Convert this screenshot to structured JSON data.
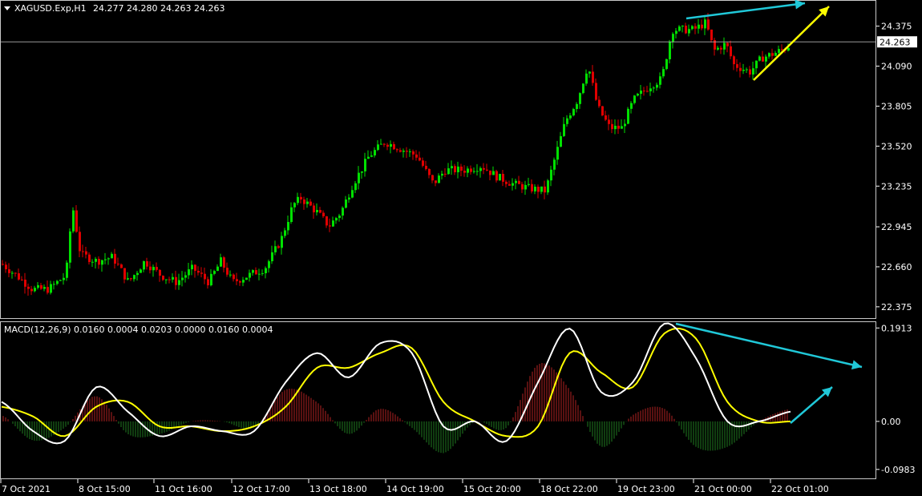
{
  "symbol_header": {
    "symbol": "XAGUSD.Exp,H1",
    "ohlc": "24.277 24.280 24.263 24.263"
  },
  "macd_header": {
    "label": "MACD(12,26,9) 0.0160 0.0004 0.0203 0.0000 0.0160 0.0004"
  },
  "colors": {
    "background": "#000000",
    "bull": "#00e000",
    "bear": "#e00000",
    "hist_up": "#b22222",
    "hist_down": "#1f7a1f",
    "macd_line": "#ffffff",
    "signal_line": "#ffff00",
    "arrow_cyan": "#20c8d8",
    "arrow_yellow": "#ffff00",
    "grid_line": "#c0c0c0"
  },
  "chart_data": [
    {
      "type": "candlestick",
      "title": "XAGUSD.Exp,H1",
      "y_ticks": [
        "24.375",
        "24.090",
        "23.805",
        "23.520",
        "23.235",
        "22.945",
        "22.660",
        "22.375"
      ],
      "ylim": [
        22.3,
        24.55
      ],
      "current_price": "24.263",
      "grid": false,
      "annotations": [
        "cyan trend arrow along highs",
        "yellow up arrow from last low"
      ]
    },
    {
      "type": "line",
      "title": "MACD(12,26,9) 0.0160 0.0004 0.0203 0.0000 0.0160 0.0004",
      "y_ticks": [
        "0.1913",
        "0.00",
        "-0.0983"
      ],
      "ylim": [
        -0.115,
        0.2
      ],
      "series": [
        {
          "values": [
            0.04,
            -0.02,
            -0.04,
            0.07,
            0.02,
            -0.03,
            -0.01,
            -0.02,
            -0.02,
            0.08,
            0.14,
            0.09,
            0.16,
            0.14,
            -0.01,
            0.0,
            -0.04,
            0.08,
            0.19,
            0.06,
            0.08,
            0.2,
            0.13,
            0.0,
            0.0,
            0.02
          ]
        },
        {
          "values": [
            0.03,
            0.01,
            -0.03,
            0.03,
            0.04,
            -0.01,
            -0.01,
            -0.02,
            -0.01,
            0.03,
            0.11,
            0.11,
            0.14,
            0.15,
            0.04,
            0.0,
            -0.03,
            -0.01,
            0.14,
            0.1,
            0.07,
            0.18,
            0.17,
            0.04,
            0.0,
            0.0
          ]
        }
      ],
      "annotations": [
        "cyan divergence arrow down-right",
        "cyan up arrow"
      ]
    }
  ],
  "x_labels": [
    "7 Oct 2021",
    "8 Oct 15:00",
    "11 Oct 16:00",
    "12 Oct 17:00",
    "13 Oct 18:00",
    "14 Oct 19:00",
    "15 Oct 20:00",
    "18 Oct 22:00",
    "19 Oct 23:00",
    "21 Oct 00:00",
    "22 Oct 01:00"
  ]
}
